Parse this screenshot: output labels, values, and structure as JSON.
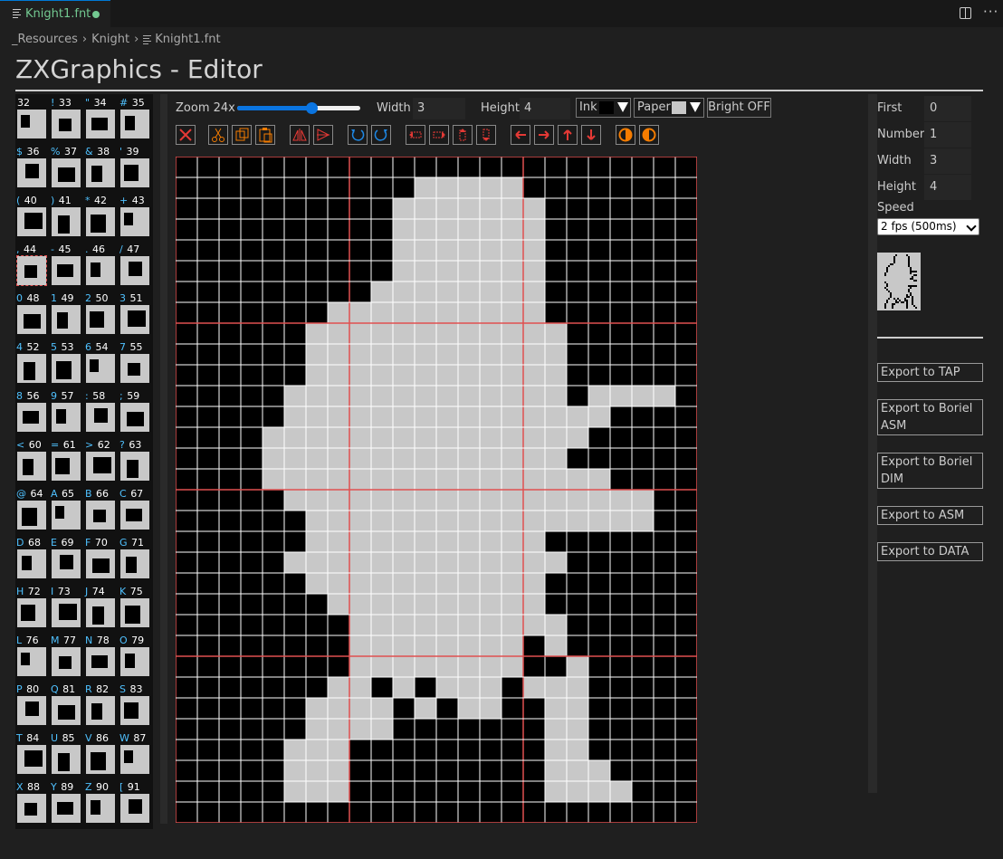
{
  "tab": {
    "title": "Knight1.fnt",
    "modified": true
  },
  "breadcrumb": {
    "items": [
      "_Resources",
      "Knight",
      "Knight1.fnt"
    ]
  },
  "page": {
    "title": "ZXGraphics - Editor"
  },
  "toolbar": {
    "zoom_label": "Zoom 24x",
    "zoom_level": 0.6,
    "width_label": "Width",
    "width_value": "3",
    "height_label": "Height",
    "height_value": "4",
    "ink_label": "Ink",
    "ink_color": "#000000",
    "paper_label": "Paper",
    "paper_color": "#c8c8c8",
    "bright_label": "Bright OFF"
  },
  "tools": [
    {
      "name": "clear-icon",
      "color": "#e53935"
    },
    {
      "name": "cut-icon",
      "color": "#f57c00"
    },
    {
      "name": "copy-icon",
      "color": "#f57c00"
    },
    {
      "name": "paste-icon",
      "color": "#f57c00"
    },
    {
      "name": "flip-horizontal-icon",
      "color": "#e53935"
    },
    {
      "name": "flip-vertical-icon",
      "color": "#e53935"
    },
    {
      "name": "rotate-left-icon",
      "color": "#1e88e5"
    },
    {
      "name": "rotate-right-icon",
      "color": "#1e88e5"
    },
    {
      "name": "shift-left-icon",
      "color": "#e53935"
    },
    {
      "name": "shift-right-icon",
      "color": "#e53935"
    },
    {
      "name": "shift-up-icon",
      "color": "#e53935"
    },
    {
      "name": "shift-down-icon",
      "color": "#e53935"
    },
    {
      "name": "move-left-icon",
      "color": "#e53935"
    },
    {
      "name": "move-right-icon",
      "color": "#e53935"
    },
    {
      "name": "move-up-icon",
      "color": "#e53935"
    },
    {
      "name": "move-down-icon",
      "color": "#e53935"
    },
    {
      "name": "invert-icon",
      "color": "#f57c00"
    },
    {
      "name": "mask-icon",
      "color": "#f57c00"
    }
  ],
  "charset": [
    {
      "sym": "",
      "code": "32"
    },
    {
      "sym": "!",
      "code": "33"
    },
    {
      "sym": "\"",
      "code": "34"
    },
    {
      "sym": "#",
      "code": "35"
    },
    {
      "sym": "$",
      "code": "36"
    },
    {
      "sym": "%",
      "code": "37"
    },
    {
      "sym": "&",
      "code": "38"
    },
    {
      "sym": "'",
      "code": "39"
    },
    {
      "sym": "(",
      "code": "40"
    },
    {
      "sym": ")",
      "code": "41"
    },
    {
      "sym": "*",
      "code": "42"
    },
    {
      "sym": "+",
      "code": "43"
    },
    {
      "sym": ",",
      "code": "44"
    },
    {
      "sym": "-",
      "code": "45"
    },
    {
      "sym": ".",
      "code": "46"
    },
    {
      "sym": "/",
      "code": "47"
    },
    {
      "sym": "0",
      "code": "48"
    },
    {
      "sym": "1",
      "code": "49"
    },
    {
      "sym": "2",
      "code": "50"
    },
    {
      "sym": "3",
      "code": "51"
    },
    {
      "sym": "4",
      "code": "52"
    },
    {
      "sym": "5",
      "code": "53"
    },
    {
      "sym": "6",
      "code": "54"
    },
    {
      "sym": "7",
      "code": "55"
    },
    {
      "sym": "8",
      "code": "56"
    },
    {
      "sym": "9",
      "code": "57"
    },
    {
      "sym": ":",
      "code": "58"
    },
    {
      "sym": ";",
      "code": "59"
    },
    {
      "sym": "<",
      "code": "60"
    },
    {
      "sym": "=",
      "code": "61"
    },
    {
      "sym": ">",
      "code": "62"
    },
    {
      "sym": "?",
      "code": "63"
    },
    {
      "sym": "@",
      "code": "64"
    },
    {
      "sym": "A",
      "code": "65"
    },
    {
      "sym": "B",
      "code": "66"
    },
    {
      "sym": "C",
      "code": "67"
    },
    {
      "sym": "D",
      "code": "68"
    },
    {
      "sym": "E",
      "code": "69"
    },
    {
      "sym": "F",
      "code": "70"
    },
    {
      "sym": "G",
      "code": "71"
    },
    {
      "sym": "H",
      "code": "72"
    },
    {
      "sym": "I",
      "code": "73"
    },
    {
      "sym": "J",
      "code": "74"
    },
    {
      "sym": "K",
      "code": "75"
    },
    {
      "sym": "L",
      "code": "76"
    },
    {
      "sym": "M",
      "code": "77"
    },
    {
      "sym": "N",
      "code": "78"
    },
    {
      "sym": "O",
      "code": "79"
    },
    {
      "sym": "P",
      "code": "80"
    },
    {
      "sym": "Q",
      "code": "81"
    },
    {
      "sym": "R",
      "code": "82"
    },
    {
      "sym": "S",
      "code": "83"
    },
    {
      "sym": "T",
      "code": "84"
    },
    {
      "sym": "U",
      "code": "85"
    },
    {
      "sym": "V",
      "code": "86"
    },
    {
      "sym": "W",
      "code": "87"
    },
    {
      "sym": "X",
      "code": "88"
    },
    {
      "sym": "Y",
      "code": "89"
    },
    {
      "sym": "Z",
      "code": "90"
    },
    {
      "sym": "[",
      "code": "91"
    }
  ],
  "selected_char": "44",
  "editor": {
    "ink_color": "#000000",
    "paper_color": "#c8c8c8",
    "gridline_color": "#ffffff",
    "cell_border_color": "#e05050",
    "bitmap": [
      "000000000000000000000000",
      "000000000001111100000000",
      "000000000011111110000000",
      "000000000011111110000000",
      "000000000011111110000000",
      "000000000011111110000000",
      "000000000111111110000000",
      "000000011111111110000000",
      "000000111111111111000000",
      "000000111111111111000000",
      "000000111111111111000000",
      "000001111111111111011110",
      "000001111111111111110000",
      "000011111111111111100000",
      "000011111111111111000000",
      "000011111111111111110000",
      "000001111111111111111100",
      "000000111111111111111100",
      "000000111111111110000000",
      "000001111111111111000000",
      "000000111111111110000000",
      "000000011111111110000000",
      "000000001111111111000000",
      "000000001111111101000000",
      "000000001111111100100000",
      "000000011010111011100000",
      "000000111101011001100000",
      "000000111100000001100000",
      "000001110000000001100000",
      "000001110000000001110000",
      "000001110000000001111000",
      "000000000000000000000000"
    ]
  },
  "properties": {
    "first_label": "First",
    "first_value": "0",
    "number_label": "Number",
    "number_value": "1",
    "width_label": "Width",
    "width_value": "3",
    "height_label": "Height",
    "height_value": "4",
    "speed_label": "Speed",
    "speed_value": "2 fps (500ms)"
  },
  "exports": [
    "Export to TAP",
    "Export to Boriel ASM",
    "Export to Boriel DIM",
    "Export to ASM",
    "Export to DATA"
  ]
}
